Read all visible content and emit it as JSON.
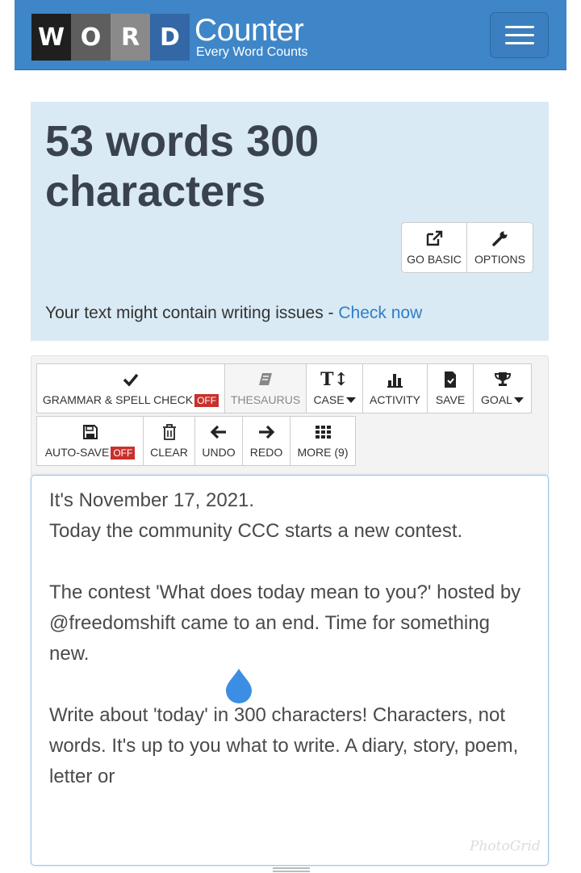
{
  "header": {
    "logo_letters": [
      "W",
      "O",
      "R",
      "D"
    ],
    "brand_title": "Counter",
    "brand_tagline": "Every Word Counts",
    "menu_icon": "hamburger-menu-icon",
    "bg_color": "#3f86c8"
  },
  "count_panel": {
    "title": "53 words 300 characters",
    "go_basic_label": "GO BASIC",
    "options_label": "OPTIONS",
    "issues_text": "Your text might contain writing issues - ",
    "check_now_link": "Check now",
    "bg_color": "#d9eaf4"
  },
  "toolbar": {
    "grammar_label": "GRAMMAR & SPELL CHECK",
    "grammar_state": "OFF",
    "thesaurus_label": "THESAURUS",
    "case_label": "CASE",
    "activity_label": "ACTIVITY",
    "save_label": "SAVE",
    "goal_label": "GOAL",
    "autosave_label": "AUTO-SAVE",
    "autosave_state": "OFF",
    "clear_label": "CLEAR",
    "undo_label": "UNDO",
    "redo_label": "REDO",
    "more_label": "MORE (9)",
    "off_color": "#c9302c"
  },
  "editor": {
    "text": "It's November 17, 2021.\nToday the community CCC starts a new contest.\n\nThe contest 'What does today mean to you?' hosted by @freedomshift came to an end. Time for something new.\n\nWrite about 'today' in 300 characters! Characters, not words. It's up to you what to write. A diary, story, poem, letter or"
  },
  "watermark": "PhotoGrid"
}
